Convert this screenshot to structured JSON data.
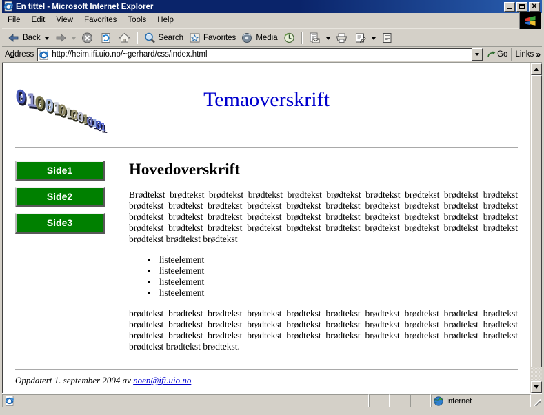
{
  "window": {
    "title": "En tittel - Microsoft Internet Explorer",
    "icon": "ie-document-icon",
    "controls": {
      "minimize": "Minimize",
      "maximize": "Maximize",
      "close": "Close"
    }
  },
  "menu": {
    "items": [
      {
        "label": "File",
        "accel": "F"
      },
      {
        "label": "Edit",
        "accel": "E"
      },
      {
        "label": "View",
        "accel": "V"
      },
      {
        "label": "Favorites",
        "accel": "a"
      },
      {
        "label": "Tools",
        "accel": "T"
      },
      {
        "label": "Help",
        "accel": "H"
      }
    ],
    "brand_icon": "windows-flag-logo"
  },
  "toolbar": {
    "back_label": "Back",
    "back_icon": "arrow-left-icon",
    "forward_icon": "arrow-right-icon",
    "stop_icon": "stop-icon",
    "refresh_icon": "refresh-icon",
    "home_icon": "home-icon",
    "search_label": "Search",
    "search_icon": "search-icon",
    "favorites_label": "Favorites",
    "favorites_icon": "favorites-star-icon",
    "media_label": "Media",
    "media_icon": "media-icon",
    "history_icon": "history-icon",
    "mail_icon": "mail-icon",
    "print_icon": "print-icon",
    "edit_icon": "edit-icon",
    "discuss_icon": "discuss-icon"
  },
  "address": {
    "label": "Address",
    "icon": "ie-document-icon",
    "url": "http://heim.ifi.uio.no/~gerhard/css/index.html",
    "placeholder": "",
    "dropdown_icon": "chevron-down-icon",
    "go_label": "Go",
    "go_icon": "go-arrow-icon",
    "links_label": "Links",
    "links_chevron": "»"
  },
  "page": {
    "logo_alt": "binary-digits-3d-logo",
    "theme_title": "Temaoverskrift",
    "nav_buttons": [
      {
        "label": "Side1"
      },
      {
        "label": "Side2"
      },
      {
        "label": "Side3"
      }
    ],
    "main_heading": "Hovedoverskrift",
    "paragraph_1": "Brødtekst brødtekst brødtekst brødtekst brødtekst brødtekst brødtekst brødtekst brødtekst brødtekst brødtekst brødtekst brødtekst brødtekst brødtekst brødtekst brødtekst brødtekst brødtekst brødtekst brødtekst brødtekst brødtekst brødtekst brødtekst brødtekst brødtekst brødtekst brødtekst brødtekst brødtekst brødtekst brødtekst brødtekst brødtekst brødtekst brødtekst brødtekst brødtekst brødtekst brødtekst brødtekst brødtekst",
    "list_items": [
      "listeelement",
      "listeelement",
      "listeelement",
      "listeelement"
    ],
    "paragraph_2": "brødtekst brødtekst brødtekst brødtekst brødtekst brødtekst brødtekst brødtekst brødtekst brødtekst brødtekst brødtekst brødtekst brødtekst brødtekst brødtekst brødtekst brødtekst brødtekst brødtekst brødtekst brødtekst brødtekst brødtekst brødtekst brødtekst brødtekst brødtekst brødtekst brødtekst brødtekst brødtekst brødtekst.",
    "footer_text": "Oppdatert 1. september 2004 av ",
    "footer_link": "noen@ifi.uio.no",
    "colors": {
      "theme_title": "#0000cd",
      "nav_button_bg": "#008000",
      "nav_button_text": "#ffffff",
      "link": "#0000cd"
    }
  },
  "statusbar": {
    "left_icon": "ie-document-icon",
    "message": "",
    "zone_icon": "globe-icon",
    "zone_label": "Internet"
  }
}
